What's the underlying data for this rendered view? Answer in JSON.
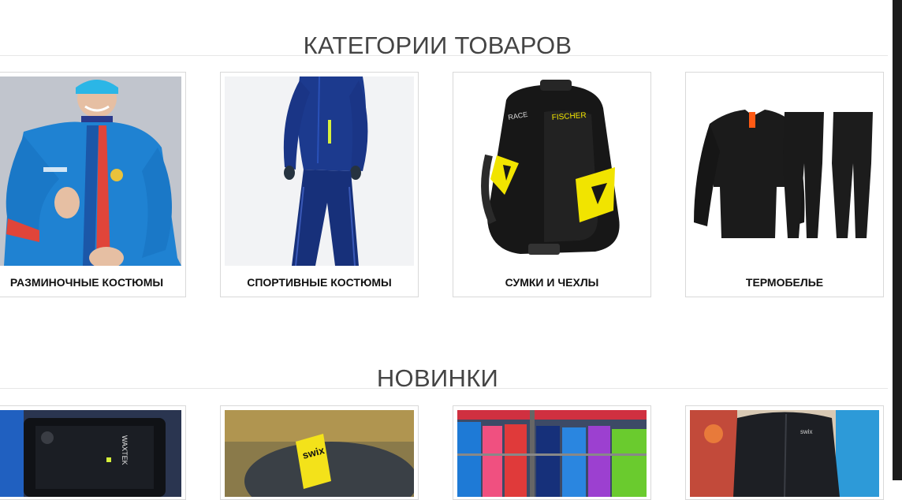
{
  "categories": {
    "title": "КАТЕГОРИИ ТОВАРОВ",
    "items": [
      {
        "label": "РАЗМИНОЧНЫЕ КОСТЮМЫ",
        "icon": "warmup-suit-photo"
      },
      {
        "label": "СПОРТИВНЫЕ КОСТЮМЫ",
        "icon": "sport-suit-photo"
      },
      {
        "label": "СУМКИ И ЧЕХЛЫ",
        "icon": "backpack-photo",
        "brand_text": "FISCHER",
        "model_text": "RACE"
      },
      {
        "label": "ТЕРМОБЕЛЬЕ",
        "icon": "thermal-underwear-photo"
      }
    ]
  },
  "new_arrivals": {
    "title": "НОВИНКИ",
    "items": [
      {
        "icon": "product-photo-1",
        "brand_text": "WAXTEK"
      },
      {
        "icon": "product-photo-2",
        "brand_text": "swix"
      },
      {
        "icon": "product-photo-3"
      },
      {
        "icon": "product-photo-4",
        "brand_text": "swix"
      }
    ]
  },
  "colors": {
    "title": "#444444",
    "border": "#d9d9d9",
    "divider": "#e6e6e6",
    "accent_yellow": "#f1e400",
    "navy": "#16307a",
    "royal_blue": "#1f6fc6"
  }
}
